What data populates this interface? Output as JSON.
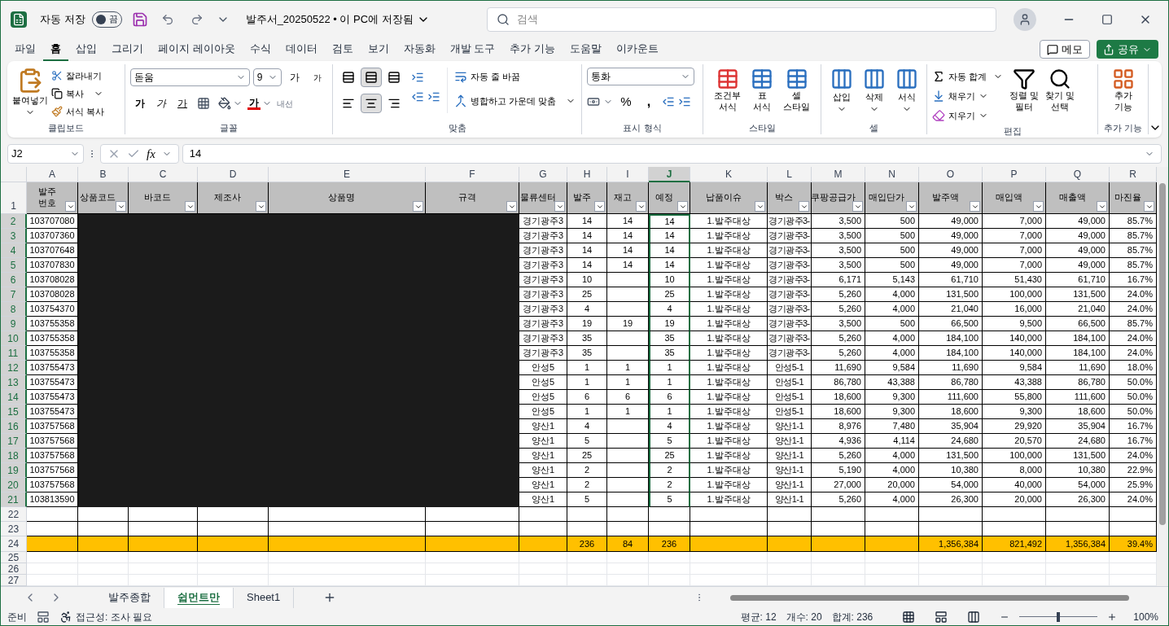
{
  "titlebar": {
    "autosave_label": "자동 저장",
    "autosave_on": false,
    "autosave_state": "끔",
    "title": "발주서_20250522 • 이 PC에 저장됨",
    "search_placeholder": "검색"
  },
  "menu": [
    {
      "label": "파일",
      "selected": false
    },
    {
      "label": "홈",
      "selected": true
    },
    {
      "label": "삽입",
      "selected": false
    },
    {
      "label": "그리기",
      "selected": false
    },
    {
      "label": "페이지 레이아웃",
      "selected": false
    },
    {
      "label": "수식",
      "selected": false
    },
    {
      "label": "데이터",
      "selected": false
    },
    {
      "label": "검토",
      "selected": false
    },
    {
      "label": "보기",
      "selected": false
    },
    {
      "label": "자동화",
      "selected": false
    },
    {
      "label": "개발 도구",
      "selected": false
    },
    {
      "label": "추가 기능",
      "selected": false
    },
    {
      "label": "도움말",
      "selected": false
    },
    {
      "label": "이카운트",
      "selected": false
    }
  ],
  "menu_buttons": {
    "memo": "메모",
    "share": "공유"
  },
  "ribbon": {
    "clipboard": {
      "label": "클립보드",
      "paste": "붙여넣기",
      "cut": "잘라내기",
      "copy": "복사",
      "format_painter": "서식 복사"
    },
    "font": {
      "label": "글꼴",
      "name": "돋움",
      "size": "9",
      "grow": "가",
      "shrink": "가",
      "bold": "가",
      "italic": "가",
      "underline": "가",
      "font_color": "가",
      "phonetic": "내선"
    },
    "alignment": {
      "label": "맞춤",
      "vertical": [
        {
          "selected": false
        },
        {
          "selected": true
        },
        {
          "selected": false
        }
      ],
      "horizontal": [
        {
          "selected": false
        },
        {
          "selected": true
        },
        {
          "selected": false
        }
      ],
      "wrap": "자동 줄 바꿈",
      "merge": "병합하고 가운데 맞춤"
    },
    "number": {
      "label": "표시 형식",
      "format": "통화",
      "percent": "%",
      "comma": ","
    },
    "styles": {
      "label": "스타일",
      "items": [
        "조건부\n서식",
        "표\n서식",
        "셀\n스타일"
      ]
    },
    "cells": {
      "label": "셀",
      "items": [
        "삽입",
        "삭제",
        "서식"
      ]
    },
    "editing": {
      "label": "편집",
      "autosum": "자동 합계",
      "fill": "채우기",
      "clear": "지우기",
      "sort": "정렬 및\n필터",
      "find": "찾기 및\n선택"
    },
    "addins": {
      "label": "추가 기능",
      "button": "추가\n기능"
    }
  },
  "formula_bar": {
    "name_box": "J2",
    "fx": "fx",
    "value": "14"
  },
  "columns": [
    {
      "letter": "A",
      "header": "발주\n번호",
      "selected": false
    },
    {
      "letter": "B",
      "header": "상품코드",
      "selected": false
    },
    {
      "letter": "C",
      "header": "바코드",
      "selected": false
    },
    {
      "letter": "D",
      "header": "제조사",
      "selected": false
    },
    {
      "letter": "E",
      "header": "상품명",
      "selected": false
    },
    {
      "letter": "F",
      "header": "규격",
      "selected": false
    },
    {
      "letter": "G",
      "header": "물류센터",
      "selected": false
    },
    {
      "letter": "H",
      "header": "발주",
      "selected": false
    },
    {
      "letter": "I",
      "header": "재고",
      "selected": false
    },
    {
      "letter": "J",
      "header": "예정",
      "selected": true
    },
    {
      "letter": "K",
      "header": "납품이슈",
      "selected": false
    },
    {
      "letter": "L",
      "header": "박스",
      "selected": false
    },
    {
      "letter": "M",
      "header": "쿠팡공급가",
      "selected": false
    },
    {
      "letter": "N",
      "header": "매입단가",
      "selected": false
    },
    {
      "letter": "O",
      "header": "발주액",
      "selected": false
    },
    {
      "letter": "P",
      "header": "매입액",
      "selected": false
    },
    {
      "letter": "Q",
      "header": "매출액",
      "selected": false
    },
    {
      "letter": "R",
      "header": "마진율",
      "selected": false
    }
  ],
  "header_row": "1",
  "rows": [
    {
      "num": "2",
      "kind": "data",
      "selected": true,
      "cells": {
        "A": "103707080",
        "G": "경기광주3",
        "H": "14",
        "I": "14",
        "J": "14",
        "K": "1.발주대상",
        "L": "경기광주3-",
        "M": "3,500",
        "N": "500",
        "O": "49,000",
        "P": "7,000",
        "Q": "49,000",
        "R": "85.7%"
      }
    },
    {
      "num": "3",
      "kind": "data",
      "selected": true,
      "cells": {
        "A": "103707360",
        "G": "경기광주3",
        "H": "14",
        "I": "14",
        "J": "14",
        "K": "1.발주대상",
        "L": "경기광주3-",
        "M": "3,500",
        "N": "500",
        "O": "49,000",
        "P": "7,000",
        "Q": "49,000",
        "R": "85.7%"
      }
    },
    {
      "num": "4",
      "kind": "data",
      "selected": true,
      "cells": {
        "A": "103707648",
        "G": "경기광주3",
        "H": "14",
        "I": "14",
        "J": "14",
        "K": "1.발주대상",
        "L": "경기광주3-",
        "M": "3,500",
        "N": "500",
        "O": "49,000",
        "P": "7,000",
        "Q": "49,000",
        "R": "85.7%"
      }
    },
    {
      "num": "5",
      "kind": "data",
      "selected": true,
      "cells": {
        "A": "103707830",
        "G": "경기광주3",
        "H": "14",
        "I": "14",
        "J": "14",
        "K": "1.발주대상",
        "L": "경기광주3-",
        "M": "3,500",
        "N": "500",
        "O": "49,000",
        "P": "7,000",
        "Q": "49,000",
        "R": "85.7%"
      }
    },
    {
      "num": "6",
      "kind": "data",
      "selected": true,
      "cells": {
        "A": "103708028",
        "G": "경기광주3",
        "H": "10",
        "J": "10",
        "K": "1.발주대상",
        "L": "경기광주3-",
        "M": "6,171",
        "N": "5,143",
        "O": "61,710",
        "P": "51,430",
        "Q": "61,710",
        "R": "16.7%"
      }
    },
    {
      "num": "7",
      "kind": "data",
      "selected": true,
      "cells": {
        "A": "103708028",
        "G": "경기광주3",
        "H": "25",
        "J": "25",
        "K": "1.발주대상",
        "L": "경기광주3-",
        "M": "5,260",
        "N": "4,000",
        "O": "131,500",
        "P": "100,000",
        "Q": "131,500",
        "R": "24.0%"
      }
    },
    {
      "num": "8",
      "kind": "data",
      "selected": true,
      "cells": {
        "A": "103754370",
        "G": "경기광주3",
        "H": "4",
        "J": "4",
        "K": "1.발주대상",
        "L": "경기광주3-",
        "M": "5,260",
        "N": "4,000",
        "O": "21,040",
        "P": "16,000",
        "Q": "21,040",
        "R": "24.0%"
      }
    },
    {
      "num": "9",
      "kind": "data",
      "selected": true,
      "cells": {
        "A": "103755358",
        "G": "경기광주3",
        "H": "19",
        "I": "19",
        "J": "19",
        "K": "1.발주대상",
        "L": "경기광주3-",
        "M": "3,500",
        "N": "500",
        "O": "66,500",
        "P": "9,500",
        "Q": "66,500",
        "R": "85.7%"
      }
    },
    {
      "num": "10",
      "kind": "data",
      "selected": true,
      "cells": {
        "A": "103755358",
        "G": "경기광주3",
        "H": "35",
        "J": "35",
        "K": "1.발주대상",
        "L": "경기광주3-",
        "M": "5,260",
        "N": "4,000",
        "O": "184,100",
        "P": "140,000",
        "Q": "184,100",
        "R": "24.0%"
      }
    },
    {
      "num": "11",
      "kind": "data",
      "selected": true,
      "cells": {
        "A": "103755358",
        "G": "경기광주3",
        "H": "35",
        "J": "35",
        "K": "1.발주대상",
        "L": "경기광주3-",
        "M": "5,260",
        "N": "4,000",
        "O": "184,100",
        "P": "140,000",
        "Q": "184,100",
        "R": "24.0%"
      }
    },
    {
      "num": "12",
      "kind": "data",
      "selected": true,
      "cells": {
        "A": "103755473",
        "G": "안성5",
        "H": "1",
        "I": "1",
        "J": "1",
        "K": "1.발주대상",
        "L": "안성5-1",
        "M": "11,690",
        "N": "9,584",
        "O": "11,690",
        "P": "9,584",
        "Q": "11,690",
        "R": "18.0%"
      }
    },
    {
      "num": "13",
      "kind": "data",
      "selected": true,
      "cells": {
        "A": "103755473",
        "G": "안성5",
        "H": "1",
        "I": "1",
        "J": "1",
        "K": "1.발주대상",
        "L": "안성5-1",
        "M": "86,780",
        "N": "43,388",
        "O": "86,780",
        "P": "43,388",
        "Q": "86,780",
        "R": "50.0%"
      }
    },
    {
      "num": "14",
      "kind": "data",
      "selected": true,
      "cells": {
        "A": "103755473",
        "G": "안성5",
        "H": "6",
        "I": "6",
        "J": "6",
        "K": "1.발주대상",
        "L": "안성5-1",
        "M": "18,600",
        "N": "9,300",
        "O": "111,600",
        "P": "55,800",
        "Q": "111,600",
        "R": "50.0%"
      }
    },
    {
      "num": "15",
      "kind": "data",
      "selected": true,
      "cells": {
        "A": "103755473",
        "G": "안성5",
        "H": "1",
        "I": "1",
        "J": "1",
        "K": "1.발주대상",
        "L": "안성5-1",
        "M": "18,600",
        "N": "9,300",
        "O": "18,600",
        "P": "9,300",
        "Q": "18,600",
        "R": "50.0%"
      }
    },
    {
      "num": "16",
      "kind": "data",
      "selected": true,
      "cells": {
        "A": "103757568",
        "G": "양산1",
        "H": "4",
        "J": "4",
        "K": "1.발주대상",
        "L": "양산1-1",
        "M": "8,976",
        "N": "7,480",
        "O": "35,904",
        "P": "29,920",
        "Q": "35,904",
        "R": "16.7%"
      }
    },
    {
      "num": "17",
      "kind": "data",
      "selected": true,
      "cells": {
        "A": "103757568",
        "G": "양산1",
        "H": "5",
        "J": "5",
        "K": "1.발주대상",
        "L": "양산1-1",
        "M": "4,936",
        "N": "4,114",
        "O": "24,680",
        "P": "20,570",
        "Q": "24,680",
        "R": "16.7%"
      }
    },
    {
      "num": "18",
      "kind": "data",
      "selected": true,
      "cells": {
        "A": "103757568",
        "G": "양산1",
        "H": "25",
        "J": "25",
        "K": "1.발주대상",
        "L": "양산1-1",
        "M": "5,260",
        "N": "4,000",
        "O": "131,500",
        "P": "100,000",
        "Q": "131,500",
        "R": "24.0%"
      }
    },
    {
      "num": "19",
      "kind": "data",
      "selected": true,
      "cells": {
        "A": "103757568",
        "G": "양산1",
        "H": "2",
        "J": "2",
        "K": "1.발주대상",
        "L": "양산1-1",
        "M": "5,190",
        "N": "4,000",
        "O": "10,380",
        "P": "8,000",
        "Q": "10,380",
        "R": "22.9%"
      }
    },
    {
      "num": "20",
      "kind": "data",
      "selected": true,
      "cells": {
        "A": "103757568",
        "G": "양산1",
        "H": "2",
        "J": "2",
        "K": "1.발주대상",
        "L": "양산1-1",
        "M": "27,000",
        "N": "20,000",
        "O": "54,000",
        "P": "40,000",
        "Q": "54,000",
        "R": "25.9%"
      }
    },
    {
      "num": "21",
      "kind": "data",
      "selected": true,
      "cells": {
        "A": "103813590",
        "G": "양산1",
        "H": "5",
        "J": "5",
        "K": "1.발주대상",
        "L": "양산1-1",
        "M": "5,260",
        "N": "4,000",
        "O": "26,300",
        "P": "20,000",
        "Q": "26,300",
        "R": "24.0%"
      }
    },
    {
      "num": "22",
      "kind": "data",
      "selected": false,
      "cells": {}
    },
    {
      "num": "23",
      "kind": "data",
      "selected": false,
      "cells": {}
    },
    {
      "num": "24",
      "kind": "total",
      "selected": false,
      "cells": {
        "H": "236",
        "I": "84",
        "J": "236",
        "O": "1,356,384",
        "P": "821,492",
        "Q": "1,356,384",
        "R": "39.4%"
      }
    },
    {
      "num": "25",
      "kind": "plain",
      "selected": false,
      "cells": {}
    },
    {
      "num": "26",
      "kind": "plain",
      "selected": false,
      "cells": {}
    },
    {
      "num": "27",
      "kind": "plain",
      "selected": false,
      "cells": {}
    }
  ],
  "sheets": [
    {
      "label": "발주종합",
      "selected": false
    },
    {
      "label": "쉽먼트만",
      "selected": true
    },
    {
      "label": "Sheet1",
      "selected": false
    }
  ],
  "status": {
    "ready": "준비",
    "accessibility": "접근성: 조사 필요",
    "average": "평균: 12",
    "count": "개수: 20",
    "sum": "합계: 236",
    "zoom": "100%",
    "zoom_slider": {
      "level": 0.5
    }
  }
}
